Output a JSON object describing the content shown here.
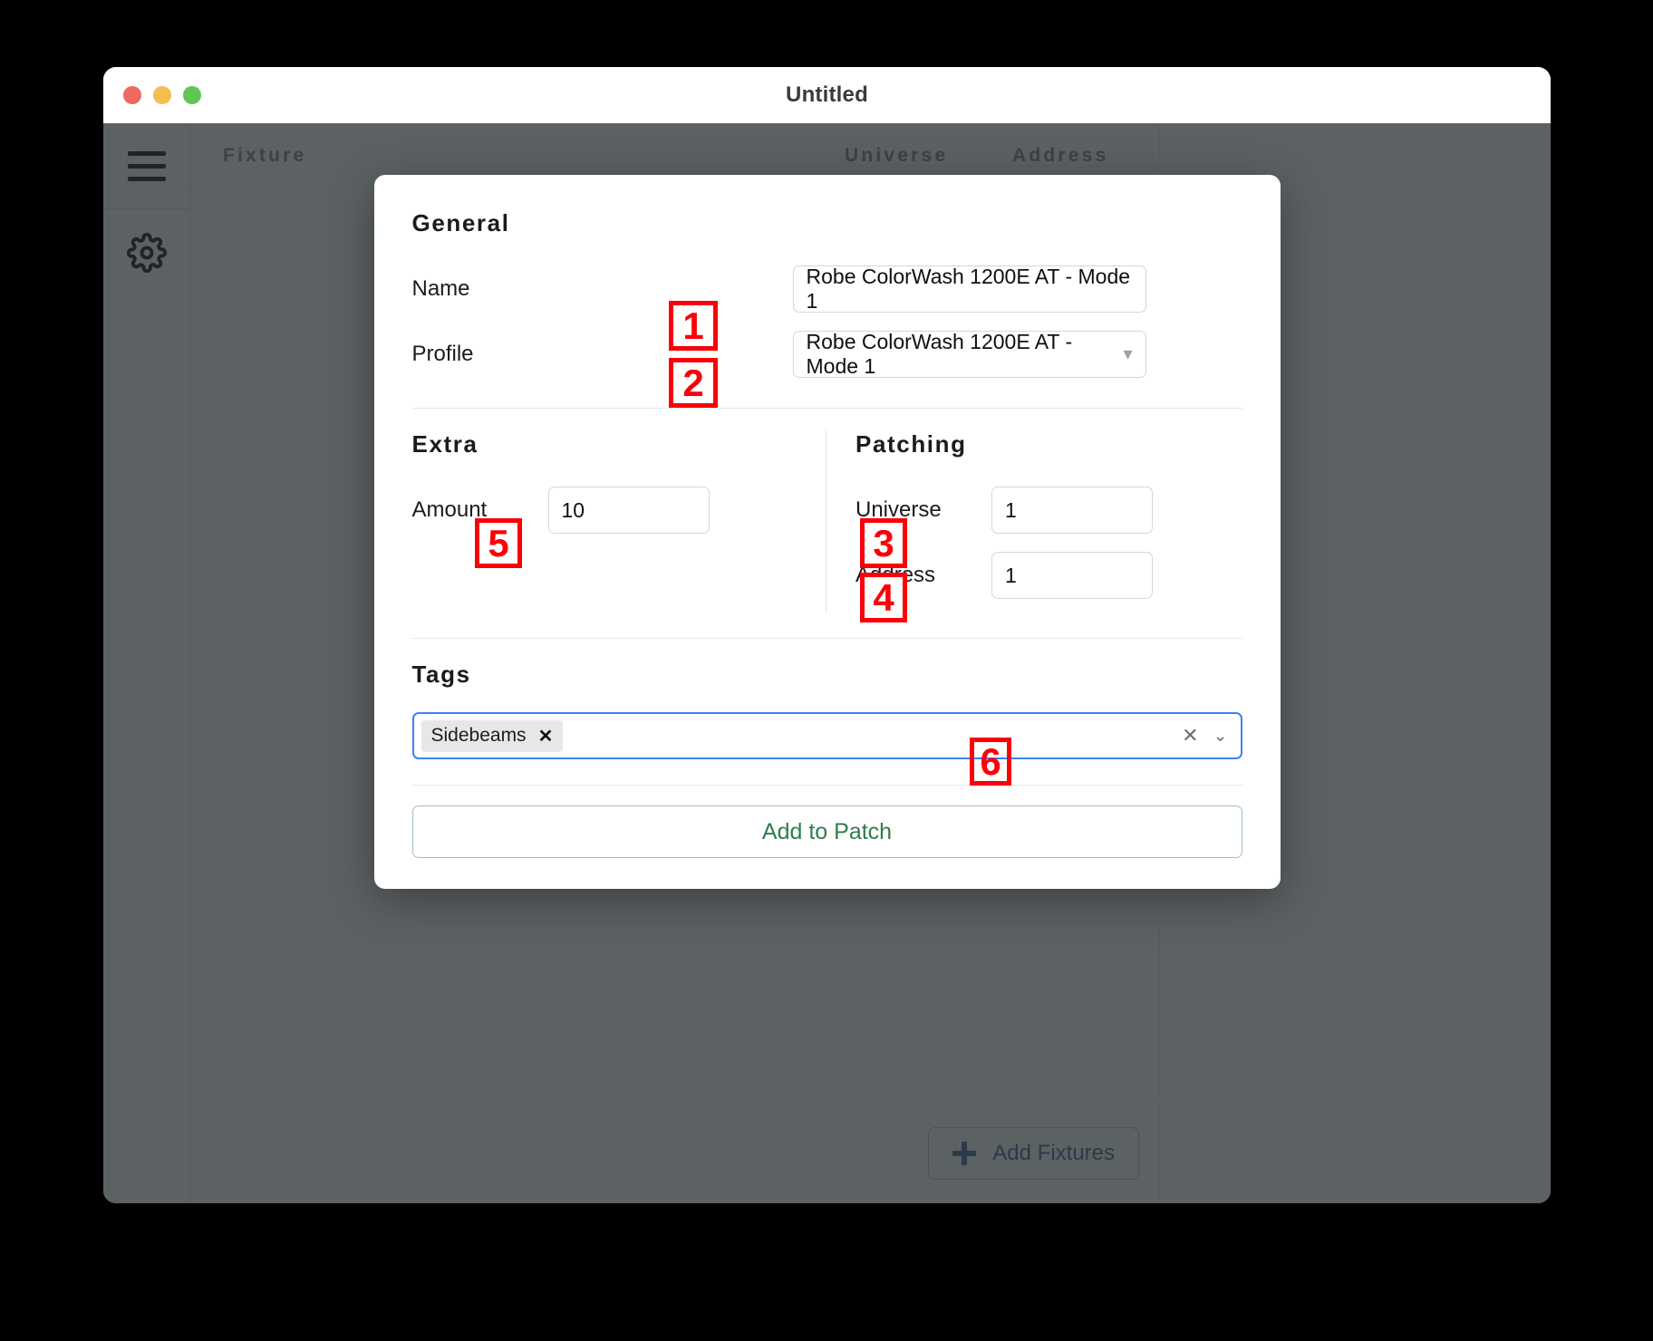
{
  "window": {
    "title": "Untitled",
    "traffic_lights": [
      "close",
      "minimize",
      "zoom"
    ]
  },
  "sidebar": {
    "items": [
      {
        "icon": "hamburger-menu-icon",
        "name": "menu"
      },
      {
        "icon": "gear-icon",
        "name": "settings"
      }
    ]
  },
  "patch_table": {
    "columns": [
      "Fixture",
      "Universe",
      "Address"
    ],
    "rows": [],
    "footer": {
      "add_fixtures_label": "Add Fixtures",
      "add_icon": "plus-icon"
    }
  },
  "dialog": {
    "general": {
      "heading": "General",
      "name": {
        "label": "Name",
        "value": "Robe ColorWash 1200E AT - Mode 1",
        "placeholder": "Name"
      },
      "profile": {
        "label": "Profile",
        "value": "Robe ColorWash 1200E AT - Mode 1",
        "chevron": "chevron-down-icon"
      }
    },
    "extra": {
      "heading": "Extra",
      "amount": {
        "label": "Amount",
        "value": "10"
      }
    },
    "patching": {
      "heading": "Patching",
      "universe": {
        "label": "Universe",
        "value": "1"
      },
      "address": {
        "label": "Address",
        "value": "1"
      }
    },
    "tags": {
      "heading": "Tags",
      "chips": [
        {
          "label": "Sidebeams",
          "remove": "✕"
        }
      ],
      "clear_icon": "✕",
      "chevron_icon": "⌄"
    },
    "submit": {
      "label": "Add to Patch"
    }
  },
  "callouts": [
    {
      "id": "1",
      "label": "1",
      "target": "name-input"
    },
    {
      "id": "2",
      "label": "2",
      "target": "profile-select"
    },
    {
      "id": "3",
      "label": "3",
      "target": "universe-input"
    },
    {
      "id": "4",
      "label": "4",
      "target": "address-input"
    },
    {
      "id": "5",
      "label": "5",
      "target": "amount-input"
    },
    {
      "id": "6",
      "label": "6",
      "target": "tags-control"
    }
  ],
  "colors": {
    "annotation": "#fb0007",
    "focus_border": "#3c82f6",
    "submit_text": "#2e7d4f",
    "app_background": "#5c6164",
    "page_background": "#000000"
  }
}
